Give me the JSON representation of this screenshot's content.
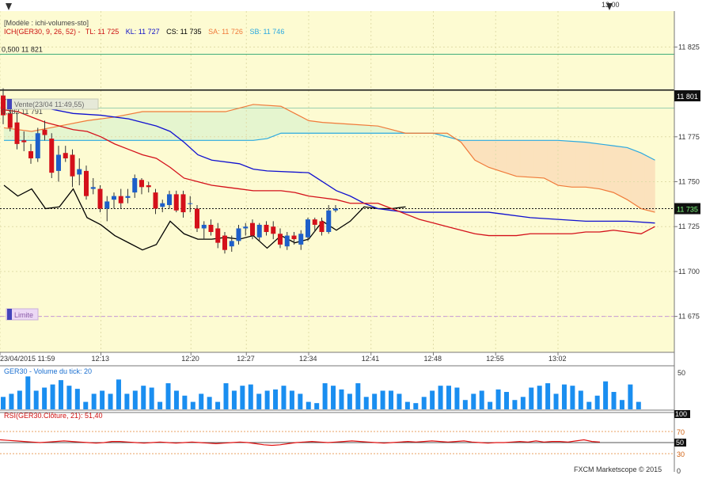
{
  "top_time_label": "13:00",
  "legend": {
    "model": "[Modèle : ichi-volumes-sto]",
    "ich_prefix": "ICH(GER30, 9, 26, 52) -",
    "tl": "TL: 11 725",
    "kl": "KL: 11 727",
    "cs": "CS: 11 735",
    "sa": "SA: 11 726",
    "sb": "SB: 11 746"
  },
  "colors": {
    "bg": "#fdfbd2",
    "bull": "#1e5fc9",
    "bear": "#d4101a",
    "tenkan": "#d4101a",
    "kijun": "#1010d0",
    "chikou": "#000000",
    "span_a": "#f07a3a",
    "span_b": "#2aa9e0",
    "kumo_bull": "#e5f5cf",
    "kumo_bear": "#fbe2bd",
    "volume": "#1a8ef0",
    "rsi": "#e01010"
  },
  "annotations": {
    "fib_label": "0,500 11 821",
    "fib_level": 11821,
    "black_level": 11801,
    "black_level_label": "11 801",
    "fib_label_2": "0,382 11 791",
    "fib_level_2": 11791,
    "sell_label": "Vente(23/04 11:49,55)",
    "limit_label": "Limite",
    "limit_level": 11675,
    "current_price": 11735,
    "current_price_label": "11 735"
  },
  "volume_panel": {
    "title": "GER30 - Volume du tick: 20",
    "axis_label": "50"
  },
  "rsi_panel": {
    "title": "RSI(GER30.Clôture, 21): 51,40",
    "levels": [
      "100",
      "70",
      "50",
      "30",
      "0"
    ]
  },
  "footer": "FXCM Marketscope © 2015",
  "chart_data": {
    "type": "candlestick",
    "instrument": "GER30",
    "ylim": [
      11655,
      11845
    ],
    "y_ticks": [
      {
        "value": 11825,
        "label": "11 825"
      },
      {
        "value": 11775,
        "label": "11 775"
      },
      {
        "value": 11750,
        "label": "11 750"
      },
      {
        "value": 11725,
        "label": "11 725"
      },
      {
        "value": 11700,
        "label": "11 700"
      },
      {
        "value": 11675,
        "label": "11 675"
      }
    ],
    "x_ticks": [
      {
        "index": 0,
        "label": "23/04/2015 11:59"
      },
      {
        "index": 7,
        "label": "12:13"
      },
      {
        "index": 13.5,
        "label": "12:20"
      },
      {
        "index": 17.5,
        "label": "12:27"
      },
      {
        "index": 22,
        "label": "12:34"
      },
      {
        "index": 26.5,
        "label": "12:41"
      },
      {
        "index": 31,
        "label": "12:48"
      },
      {
        "index": 35.5,
        "label": "12:55"
      },
      {
        "index": 40,
        "label": "13:02"
      }
    ],
    "candles": [
      {
        "o": 11798,
        "h": 11802,
        "l": 11782,
        "c": 11787
      },
      {
        "o": 11788,
        "h": 11793,
        "l": 11778,
        "c": 11780
      },
      {
        "o": 11783,
        "h": 11788,
        "l": 11768,
        "c": 11771
      },
      {
        "o": 11773,
        "h": 11778,
        "l": 11767,
        "c": 11772
      },
      {
        "o": 11767,
        "h": 11771,
        "l": 11760,
        "c": 11763
      },
      {
        "o": 11763,
        "h": 11780,
        "l": 11761,
        "c": 11777
      },
      {
        "o": 11779,
        "h": 11784,
        "l": 11773,
        "c": 11776
      },
      {
        "o": 11774,
        "h": 11777,
        "l": 11752,
        "c": 11755
      },
      {
        "o": 11756,
        "h": 11770,
        "l": 11750,
        "c": 11765
      },
      {
        "o": 11766,
        "h": 11770,
        "l": 11761,
        "c": 11763
      },
      {
        "o": 11765,
        "h": 11768,
        "l": 11747,
        "c": 11753
      },
      {
        "o": 11754,
        "h": 11763,
        "l": 11748,
        "c": 11757
      },
      {
        "o": 11756,
        "h": 11759,
        "l": 11740,
        "c": 11742
      },
      {
        "o": 11746,
        "h": 11752,
        "l": 11743,
        "c": 11747
      },
      {
        "o": 11746,
        "h": 11748,
        "l": 11733,
        "c": 11735
      },
      {
        "o": 11735,
        "h": 11742,
        "l": 11728,
        "c": 11739
      },
      {
        "o": 11740,
        "h": 11744,
        "l": 11735,
        "c": 11742
      },
      {
        "o": 11742,
        "h": 11746,
        "l": 11735,
        "c": 11738
      },
      {
        "o": 11741,
        "h": 11746,
        "l": 11738,
        "c": 11742
      },
      {
        "o": 11744,
        "h": 11754,
        "l": 11741,
        "c": 11752
      },
      {
        "o": 11751,
        "h": 11752,
        "l": 11743,
        "c": 11747
      },
      {
        "o": 11748,
        "h": 11750,
        "l": 11744,
        "c": 11747
      },
      {
        "o": 11744,
        "h": 11746,
        "l": 11732,
        "c": 11735
      },
      {
        "o": 11736,
        "h": 11740,
        "l": 11733,
        "c": 11738
      },
      {
        "o": 11737,
        "h": 11745,
        "l": 11735,
        "c": 11743
      },
      {
        "o": 11743,
        "h": 11745,
        "l": 11733,
        "c": 11734
      },
      {
        "o": 11743,
        "h": 11745,
        "l": 11730,
        "c": 11733
      },
      {
        "o": 11738,
        "h": 11742,
        "l": 11733,
        "c": 11738
      },
      {
        "o": 11735,
        "h": 11737,
        "l": 11722,
        "c": 11724
      },
      {
        "o": 11724,
        "h": 11728,
        "l": 11718,
        "c": 11726
      },
      {
        "o": 11726,
        "h": 11729,
        "l": 11720,
        "c": 11722
      },
      {
        "o": 11724,
        "h": 11727,
        "l": 11713,
        "c": 11716
      },
      {
        "o": 11720,
        "h": 11722,
        "l": 11710,
        "c": 11712
      },
      {
        "o": 11714,
        "h": 11720,
        "l": 11711,
        "c": 11717
      },
      {
        "o": 11717,
        "h": 11726,
        "l": 11715,
        "c": 11724
      },
      {
        "o": 11724,
        "h": 11727,
        "l": 11720,
        "c": 11725
      },
      {
        "o": 11727,
        "h": 11729,
        "l": 11718,
        "c": 11720
      },
      {
        "o": 11719,
        "h": 11727,
        "l": 11717,
        "c": 11726
      },
      {
        "o": 11726,
        "h": 11728,
        "l": 11720,
        "c": 11722
      },
      {
        "o": 11725,
        "h": 11728,
        "l": 11718,
        "c": 11721
      },
      {
        "o": 11721,
        "h": 11724,
        "l": 11713,
        "c": 11715
      },
      {
        "o": 11714,
        "h": 11722,
        "l": 11712,
        "c": 11720
      },
      {
        "o": 11720,
        "h": 11722,
        "l": 11715,
        "c": 11718
      },
      {
        "o": 11715,
        "h": 11723,
        "l": 11712,
        "c": 11721
      },
      {
        "o": 11719,
        "h": 11730,
        "l": 11717,
        "c": 11729
      },
      {
        "o": 11729,
        "h": 11730,
        "l": 11722,
        "c": 11726
      },
      {
        "o": 11728,
        "h": 11730,
        "l": 11720,
        "c": 11722
      },
      {
        "o": 11722,
        "h": 11737,
        "l": 11721,
        "c": 11734
      },
      {
        "o": 11734,
        "h": 11737,
        "l": 11733,
        "c": 11735
      }
    ],
    "tenkan": [
      {
        "i": 0,
        "v": 11790
      },
      {
        "i": 1,
        "v": 11789
      },
      {
        "i": 2,
        "v": 11786
      },
      {
        "i": 3,
        "v": 11783
      },
      {
        "i": 4,
        "v": 11781
      },
      {
        "i": 5,
        "v": 11779
      },
      {
        "i": 6,
        "v": 11778
      },
      {
        "i": 7,
        "v": 11775
      },
      {
        "i": 8,
        "v": 11771
      },
      {
        "i": 9,
        "v": 11768
      },
      {
        "i": 10,
        "v": 11765
      },
      {
        "i": 11,
        "v": 11763
      },
      {
        "i": 12,
        "v": 11758
      },
      {
        "i": 13,
        "v": 11752
      },
      {
        "i": 14,
        "v": 11750
      },
      {
        "i": 15,
        "v": 11748
      },
      {
        "i": 16,
        "v": 11747
      },
      {
        "i": 17,
        "v": 11746
      },
      {
        "i": 18,
        "v": 11745
      },
      {
        "i": 19,
        "v": 11745
      },
      {
        "i": 20,
        "v": 11745
      },
      {
        "i": 21,
        "v": 11744
      },
      {
        "i": 22,
        "v": 11742
      },
      {
        "i": 23,
        "v": 11741
      },
      {
        "i": 24,
        "v": 11740
      },
      {
        "i": 25,
        "v": 11738
      },
      {
        "i": 26,
        "v": 11738
      },
      {
        "i": 27,
        "v": 11738
      },
      {
        "i": 28,
        "v": 11735
      },
      {
        "i": 29,
        "v": 11732
      },
      {
        "i": 30,
        "v": 11729
      },
      {
        "i": 31,
        "v": 11727
      },
      {
        "i": 32,
        "v": 11725
      },
      {
        "i": 33,
        "v": 11723
      },
      {
        "i": 34,
        "v": 11721
      },
      {
        "i": 35,
        "v": 11720
      },
      {
        "i": 36,
        "v": 11720
      },
      {
        "i": 37,
        "v": 11720
      },
      {
        "i": 38,
        "v": 11721
      },
      {
        "i": 39,
        "v": 11721
      },
      {
        "i": 40,
        "v": 11721
      },
      {
        "i": 41,
        "v": 11721
      },
      {
        "i": 42,
        "v": 11722
      },
      {
        "i": 43,
        "v": 11722
      },
      {
        "i": 44,
        "v": 11723
      },
      {
        "i": 45,
        "v": 11722
      },
      {
        "i": 46,
        "v": 11721
      },
      {
        "i": 47,
        "v": 11725
      }
    ],
    "kijun": [
      {
        "i": 0,
        "v": 11796
      },
      {
        "i": 3,
        "v": 11791
      },
      {
        "i": 5,
        "v": 11788
      },
      {
        "i": 7,
        "v": 11787
      },
      {
        "i": 9,
        "v": 11785
      },
      {
        "i": 11,
        "v": 11781
      },
      {
        "i": 12,
        "v": 11778
      },
      {
        "i": 13,
        "v": 11772
      },
      {
        "i": 14,
        "v": 11765
      },
      {
        "i": 15,
        "v": 11762
      },
      {
        "i": 17,
        "v": 11760
      },
      {
        "i": 18,
        "v": 11757
      },
      {
        "i": 19,
        "v": 11756
      },
      {
        "i": 22,
        "v": 11755
      },
      {
        "i": 24,
        "v": 11745
      },
      {
        "i": 25,
        "v": 11742
      },
      {
        "i": 26,
        "v": 11738
      },
      {
        "i": 27,
        "v": 11735
      },
      {
        "i": 28,
        "v": 11734
      },
      {
        "i": 29,
        "v": 11733
      },
      {
        "i": 30,
        "v": 11733
      },
      {
        "i": 35,
        "v": 11733
      },
      {
        "i": 36,
        "v": 11732
      },
      {
        "i": 38,
        "v": 11730
      },
      {
        "i": 40,
        "v": 11729
      },
      {
        "i": 42,
        "v": 11728
      },
      {
        "i": 45,
        "v": 11728
      },
      {
        "i": 47,
        "v": 11727
      }
    ],
    "chikou": [
      {
        "i": 0,
        "v": 11748
      },
      {
        "i": 1,
        "v": 11742
      },
      {
        "i": 2,
        "v": 11746
      },
      {
        "i": 3,
        "v": 11735
      },
      {
        "i": 4,
        "v": 11736
      },
      {
        "i": 5,
        "v": 11746
      },
      {
        "i": 6,
        "v": 11730
      },
      {
        "i": 7,
        "v": 11726
      },
      {
        "i": 8,
        "v": 11720
      },
      {
        "i": 9,
        "v": 11716
      },
      {
        "i": 10,
        "v": 11712
      },
      {
        "i": 11,
        "v": 11715
      },
      {
        "i": 12,
        "v": 11728
      },
      {
        "i": 13,
        "v": 11721
      },
      {
        "i": 14,
        "v": 11718
      },
      {
        "i": 15,
        "v": 11718
      },
      {
        "i": 16,
        "v": 11719
      },
      {
        "i": 17,
        "v": 11718
      },
      {
        "i": 18,
        "v": 11720
      },
      {
        "i": 19,
        "v": 11713
      },
      {
        "i": 20,
        "v": 11720
      },
      {
        "i": 21,
        "v": 11716
      },
      {
        "i": 22,
        "v": 11718
      },
      {
        "i": 23,
        "v": 11728
      },
      {
        "i": 24,
        "v": 11723
      },
      {
        "i": 25,
        "v": 11728
      },
      {
        "i": 26,
        "v": 11736
      },
      {
        "i": 27,
        "v": 11735
      },
      {
        "i": 28,
        "v": 11735
      },
      {
        "i": 29,
        "v": 11736
      }
    ],
    "span_a": [
      {
        "i": 0,
        "v": 11780
      },
      {
        "i": 2,
        "v": 11778
      },
      {
        "i": 4,
        "v": 11781
      },
      {
        "i": 6,
        "v": 11784
      },
      {
        "i": 8,
        "v": 11786
      },
      {
        "i": 10,
        "v": 11789
      },
      {
        "i": 12,
        "v": 11789
      },
      {
        "i": 14,
        "v": 11789
      },
      {
        "i": 16,
        "v": 11789
      },
      {
        "i": 18,
        "v": 11793
      },
      {
        "i": 20,
        "v": 11792
      },
      {
        "i": 21,
        "v": 11788
      },
      {
        "i": 22,
        "v": 11784
      },
      {
        "i": 23,
        "v": 11783
      },
      {
        "i": 25,
        "v": 11782
      },
      {
        "i": 27,
        "v": 11781
      },
      {
        "i": 28,
        "v": 11779
      },
      {
        "i": 29,
        "v": 11777
      },
      {
        "i": 32,
        "v": 11777
      },
      {
        "i": 33,
        "v": 11772
      },
      {
        "i": 34,
        "v": 11762
      },
      {
        "i": 35,
        "v": 11758
      },
      {
        "i": 37,
        "v": 11753
      },
      {
        "i": 39,
        "v": 11752
      },
      {
        "i": 40,
        "v": 11748
      },
      {
        "i": 41,
        "v": 11747
      },
      {
        "i": 42,
        "v": 11747
      },
      {
        "i": 43,
        "v": 11746
      },
      {
        "i": 44,
        "v": 11744
      },
      {
        "i": 45,
        "v": 11740
      },
      {
        "i": 46,
        "v": 11735
      },
      {
        "i": 47,
        "v": 11733
      }
    ],
    "span_b": [
      {
        "i": 0,
        "v": 11773
      },
      {
        "i": 4,
        "v": 11773
      },
      {
        "i": 6,
        "v": 11773
      },
      {
        "i": 8,
        "v": 11773
      },
      {
        "i": 10,
        "v": 11773
      },
      {
        "i": 12,
        "v": 11773
      },
      {
        "i": 14,
        "v": 11773
      },
      {
        "i": 16,
        "v": 11773
      },
      {
        "i": 18,
        "v": 11773
      },
      {
        "i": 19,
        "v": 11774
      },
      {
        "i": 20,
        "v": 11777
      },
      {
        "i": 23,
        "v": 11777
      },
      {
        "i": 25,
        "v": 11777
      },
      {
        "i": 27,
        "v": 11777
      },
      {
        "i": 29,
        "v": 11777
      },
      {
        "i": 31,
        "v": 11777
      },
      {
        "i": 32,
        "v": 11775
      },
      {
        "i": 33,
        "v": 11773
      },
      {
        "i": 40,
        "v": 11773
      },
      {
        "i": 42,
        "v": 11772
      },
      {
        "i": 44,
        "v": 11770
      },
      {
        "i": 45,
        "v": 11769
      },
      {
        "i": 46,
        "v": 11766
      },
      {
        "i": 47,
        "v": 11762
      }
    ],
    "volume": {
      "ylim": [
        0,
        65
      ],
      "values": [
        20,
        25,
        30,
        53,
        30,
        35,
        40,
        47,
        38,
        33,
        12,
        25,
        30,
        25,
        48,
        25,
        30,
        38,
        35,
        12,
        42,
        30,
        22,
        12,
        25,
        20,
        12,
        42,
        30,
        38,
        40,
        25,
        30,
        32,
        38,
        30,
        25,
        12,
        10,
        42,
        38,
        32,
        25,
        42,
        20,
        25,
        30,
        30,
        25,
        12,
        10,
        20,
        30,
        38,
        38,
        35,
        15,
        25,
        30,
        12,
        32,
        28,
        15,
        20,
        35,
        38,
        42,
        25,
        40,
        38,
        30,
        12,
        22,
        45,
        28,
        15,
        40,
        12
      ]
    },
    "rsi": {
      "ylim": [
        0,
        100
      ],
      "levels": [
        70,
        50,
        30
      ],
      "values": [
        55,
        54,
        53,
        52,
        51,
        50,
        51,
        52,
        53,
        52,
        51,
        50,
        49,
        50,
        52,
        52,
        51,
        50,
        49,
        50,
        51,
        50,
        49,
        50,
        51,
        50,
        49,
        48,
        49,
        50,
        51,
        50,
        48,
        46,
        45,
        46,
        48,
        50,
        51,
        52,
        51,
        50,
        51,
        52,
        53,
        52,
        51,
        50,
        49,
        50,
        51,
        52,
        51,
        52,
        53,
        52,
        51,
        52,
        53,
        51,
        50,
        49,
        50,
        50,
        51,
        52,
        51,
        53,
        51,
        52,
        52,
        51,
        53,
        55,
        52,
        51
      ]
    }
  }
}
